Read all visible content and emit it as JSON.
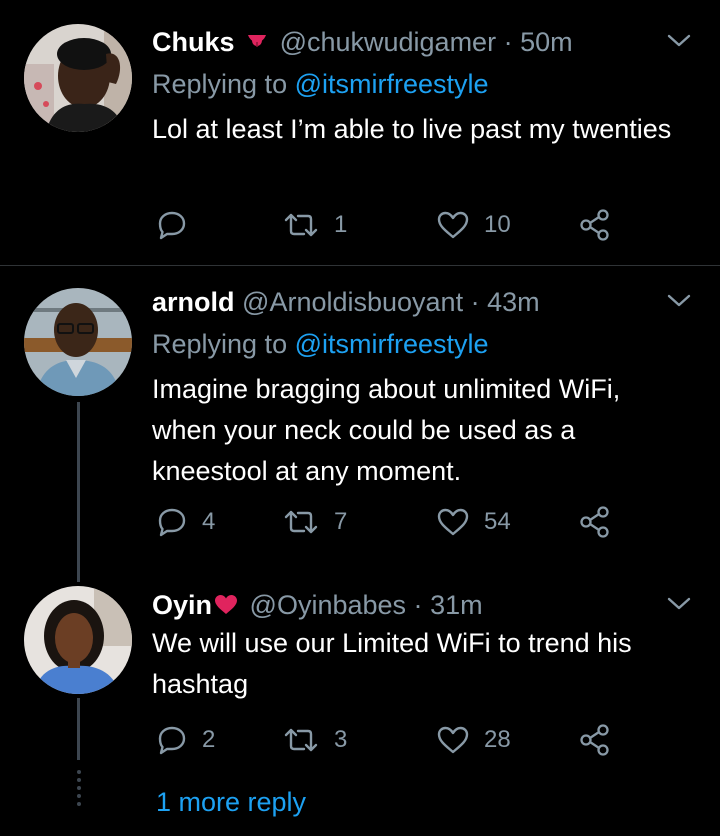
{
  "tweets": [
    {
      "name": "Chuks",
      "emoji": "tongue-emoji",
      "handle": "@chukwudigamer",
      "separator": "·",
      "time": "50m",
      "replying_prefix": "Replying to",
      "replying_handle": "@itsmirfreestyle",
      "text": "Lol at least I’m able to live past my twenties",
      "replies": "",
      "retweets": "1",
      "likes": "10"
    },
    {
      "name": "arnold",
      "handle": "@Arnoldisbuoyant",
      "separator": "·",
      "time": "43m",
      "replying_prefix": "Replying to",
      "replying_handle": "@itsmirfreestyle",
      "text": "Imagine bragging about unlimited WiFi, when your neck could be used as a kneestool at any moment.",
      "replies": "4",
      "retweets": "7",
      "likes": "54"
    },
    {
      "name": "Oyin",
      "emoji": "heart-emoji",
      "handle": "@Oyinbabes",
      "separator": "·",
      "time": "31m",
      "text": "We will use our Limited WiFi to trend his hashtag",
      "replies": "2",
      "retweets": "3",
      "likes": "28"
    }
  ],
  "more_replies_label": "1 more reply",
  "colors": {
    "background": "#000000",
    "text": "#ffffff",
    "secondary": "#8899a6",
    "link": "#1da1f2",
    "heart": "#e0245e",
    "tongue": "#e0245e"
  }
}
